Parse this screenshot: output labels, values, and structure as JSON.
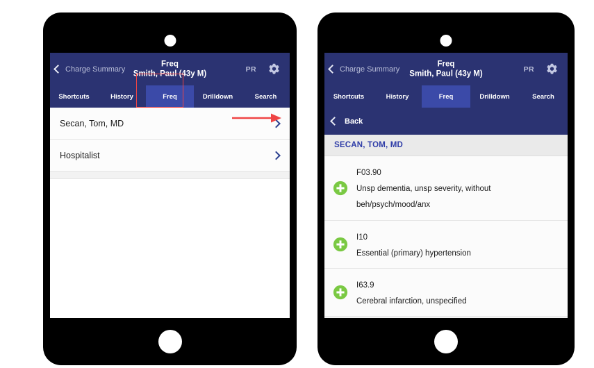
{
  "shared": {
    "nav": {
      "back_label": "Charge Summary",
      "title_line1": "Freq",
      "title_line2": "Smith, Paul (43y M)",
      "pr_label": "PR",
      "gear_icon": "gear-icon",
      "back_icon": "chevron-left-icon"
    },
    "tabs": [
      {
        "label": "Shortcuts",
        "active": false
      },
      {
        "label": "History",
        "active": false
      },
      {
        "label": "Freq",
        "active": true
      },
      {
        "label": "Drilldown",
        "active": false
      },
      {
        "label": "Search",
        "active": false
      }
    ],
    "colors": {
      "navy": "#2b3372",
      "active_tab": "#3b4aa8",
      "section_text": "#2f3da8",
      "annotation_red": "#ef4444",
      "plus_green": "#7ac943",
      "chevron_blue": "#2b3f8f"
    }
  },
  "left_device": {
    "providers": [
      {
        "label": "Secan, Tom, MD",
        "chevron_icon": "chevron-right-icon",
        "annotated": true
      },
      {
        "label": "Hospitalist",
        "chevron_icon": "chevron-right-icon",
        "annotated": false
      }
    ],
    "annotations": {
      "tab_highlight_target": "Freq",
      "arrow_target": "Secan, Tom, MD"
    }
  },
  "right_device": {
    "subbar": {
      "back_label": "Back",
      "back_icon": "chevron-left-icon"
    },
    "section_header": "SECAN, TOM, MD",
    "codes": [
      {
        "code": "F03.90",
        "description_lines": [
          "Unsp dementia, unsp severity, without",
          "beh/psych/mood/anx"
        ],
        "add_icon": "plus-circle-icon"
      },
      {
        "code": "I10",
        "description_lines": [
          "Essential (primary) hypertension"
        ],
        "add_icon": "plus-circle-icon"
      },
      {
        "code": "I63.9",
        "description_lines": [
          "Cerebral infarction, unspecified"
        ],
        "add_icon": "plus-circle-icon"
      }
    ]
  }
}
